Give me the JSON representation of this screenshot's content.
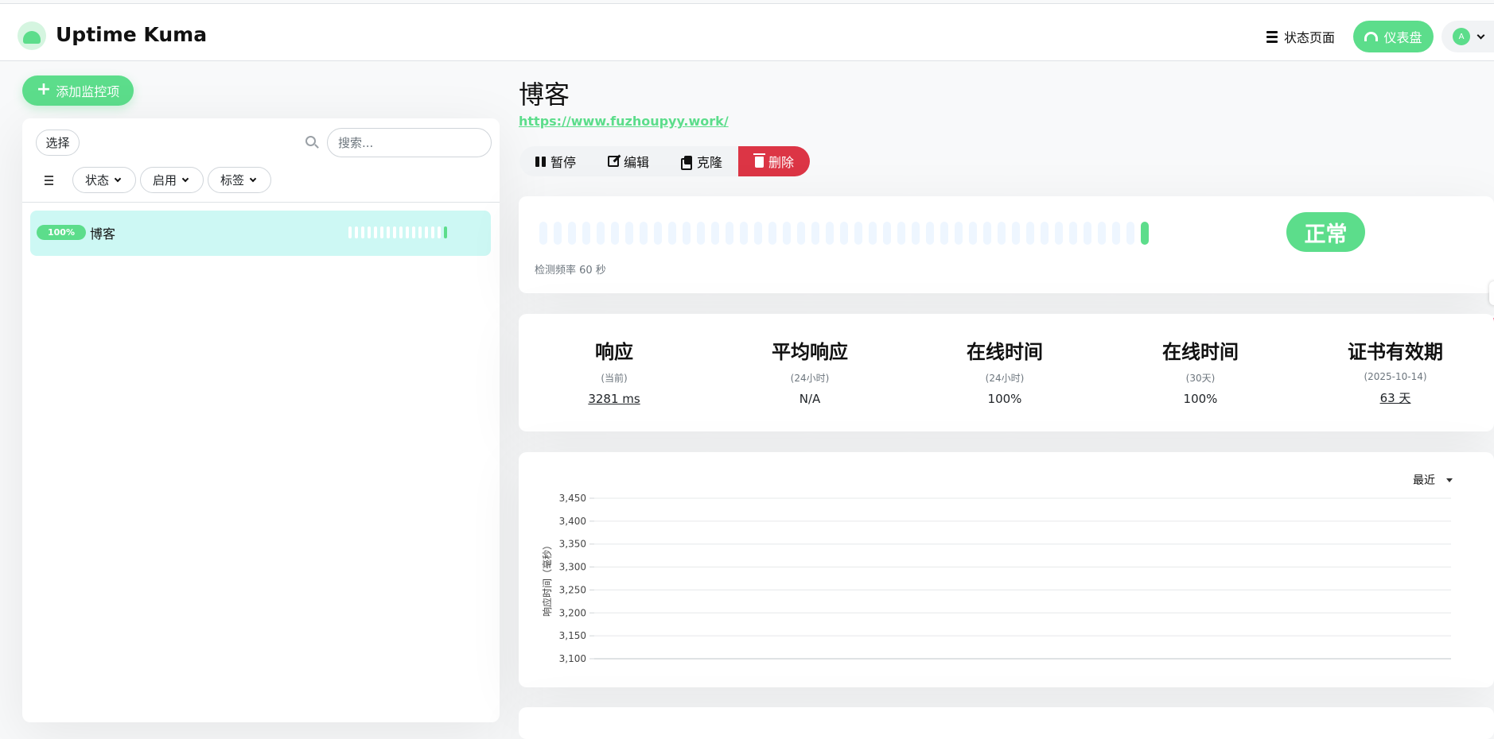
{
  "header": {
    "brand": "Uptime Kuma",
    "status_page": "状态页面",
    "dashboard": "仪表盘",
    "avatar_initial": "A"
  },
  "sidebar": {
    "add_button": "添加监控项",
    "select_button": "选择",
    "search_placeholder": "搜索...",
    "filters": [
      "状态",
      "启用",
      "标签"
    ],
    "monitors": [
      {
        "name": "博客",
        "uptime": "100%",
        "beats_total": 16,
        "beats_up": 1
      }
    ]
  },
  "detail": {
    "title": "博客",
    "url": "https://www.fuzhoupyy.work/",
    "actions": {
      "pause": "暂停",
      "edit": "编辑",
      "clone": "克隆",
      "delete": "删除"
    },
    "heartbeat": {
      "beats_total": 43,
      "beats_up": 1,
      "status": "正常",
      "interval": "检测频率 60 秒"
    },
    "stats": [
      {
        "title": "响应",
        "sub": "(当前)",
        "value": "3281 ms",
        "link": true
      },
      {
        "title": "平均响应",
        "sub": "(24小时)",
        "value": "N/A",
        "link": false
      },
      {
        "title": "在线时间",
        "sub": "(24小时)",
        "value": "100%",
        "link": false
      },
      {
        "title": "在线时间",
        "sub": "(30天)",
        "value": "100%",
        "link": false
      },
      {
        "title": "证书有效期",
        "sub": "(2025-10-14)",
        "value": "63 天",
        "link": true
      }
    ],
    "chart_range": "最近"
  },
  "colors": {
    "accent": "#5cdd8b",
    "danger": "#dc3545",
    "selected_row": "#cdf8f4"
  },
  "chart_data": {
    "type": "line",
    "title": "",
    "ylabel": "响应时间（毫秒）",
    "xlabel": "",
    "ylim": [
      3100,
      3450
    ],
    "yticks": [
      3450,
      3400,
      3350,
      3300,
      3250,
      3200,
      3150,
      3100
    ],
    "ytick_labels": [
      "3,450",
      "3,400",
      "3,350",
      "3,300",
      "3,250",
      "3,200",
      "3,150",
      "3,100"
    ],
    "series": [],
    "grid": true
  }
}
